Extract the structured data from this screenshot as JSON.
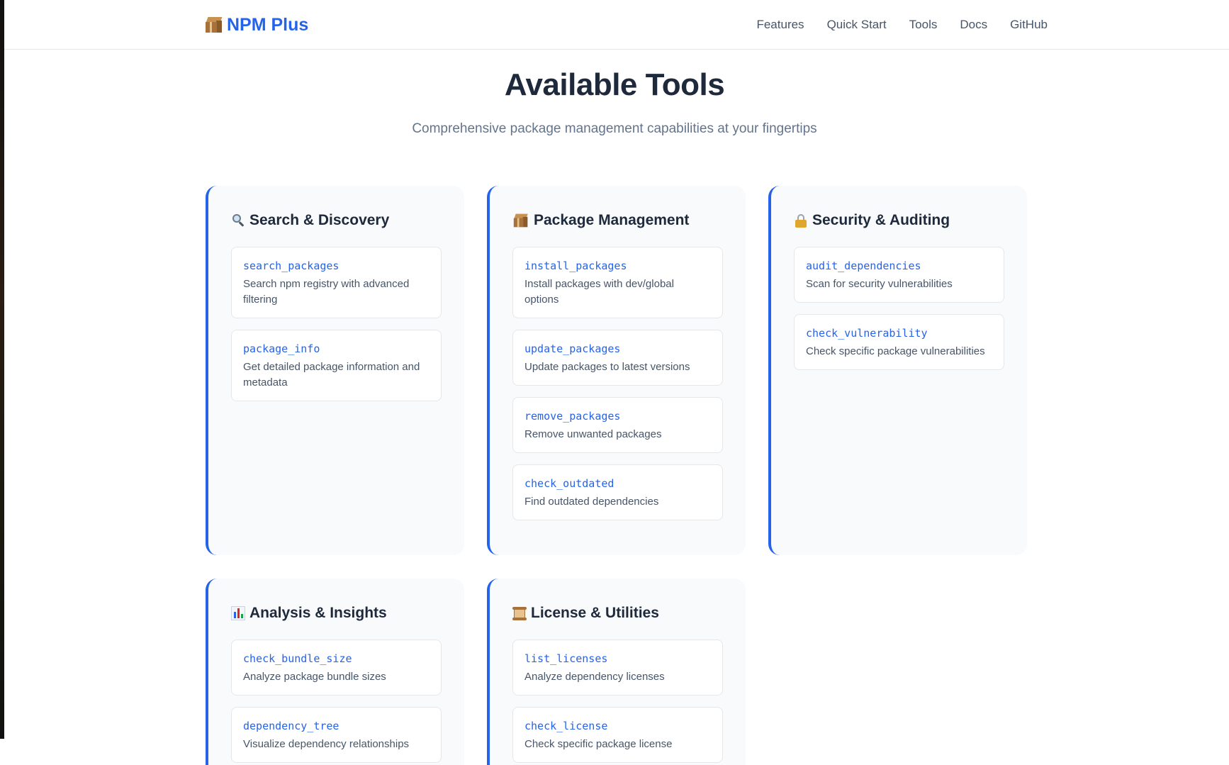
{
  "brand": {
    "name": "NPM Plus",
    "icon": "package-icon"
  },
  "nav": [
    "Features",
    "Quick Start",
    "Tools",
    "Docs",
    "GitHub"
  ],
  "hero": {
    "title": "Available Tools",
    "subtitle": "Comprehensive package management capabilities at your fingertips"
  },
  "categories": [
    {
      "title": "Search & Discovery",
      "icon": "magnifier-icon",
      "tools": [
        {
          "name": "search_packages",
          "desc": "Search npm registry with advanced filtering"
        },
        {
          "name": "package_info",
          "desc": "Get detailed package information and metadata"
        }
      ]
    },
    {
      "title": "Package Management",
      "icon": "package-icon",
      "tools": [
        {
          "name": "install_packages",
          "desc": "Install packages with dev/global options"
        },
        {
          "name": "update_packages",
          "desc": "Update packages to latest versions"
        },
        {
          "name": "remove_packages",
          "desc": "Remove unwanted packages"
        },
        {
          "name": "check_outdated",
          "desc": "Find outdated dependencies"
        }
      ]
    },
    {
      "title": "Security & Auditing",
      "icon": "lock-icon",
      "tools": [
        {
          "name": "audit_dependencies",
          "desc": "Scan for security vulnerabilities"
        },
        {
          "name": "check_vulnerability",
          "desc": "Check specific package vulnerabilities"
        }
      ]
    },
    {
      "title": "Analysis & Insights",
      "icon": "bar-chart-icon",
      "tools": [
        {
          "name": "check_bundle_size",
          "desc": "Analyze package bundle sizes"
        },
        {
          "name": "dependency_tree",
          "desc": "Visualize dependency relationships"
        }
      ]
    },
    {
      "title": "License & Utilities",
      "icon": "scroll-icon",
      "tools": [
        {
          "name": "list_licenses",
          "desc": "Analyze dependency licenses"
        },
        {
          "name": "check_license",
          "desc": "Check specific package license"
        }
      ]
    }
  ],
  "colors": {
    "accent": "#2563eb",
    "card_bg": "#f8fafc",
    "heading": "#1e293b",
    "muted": "#64748b"
  }
}
